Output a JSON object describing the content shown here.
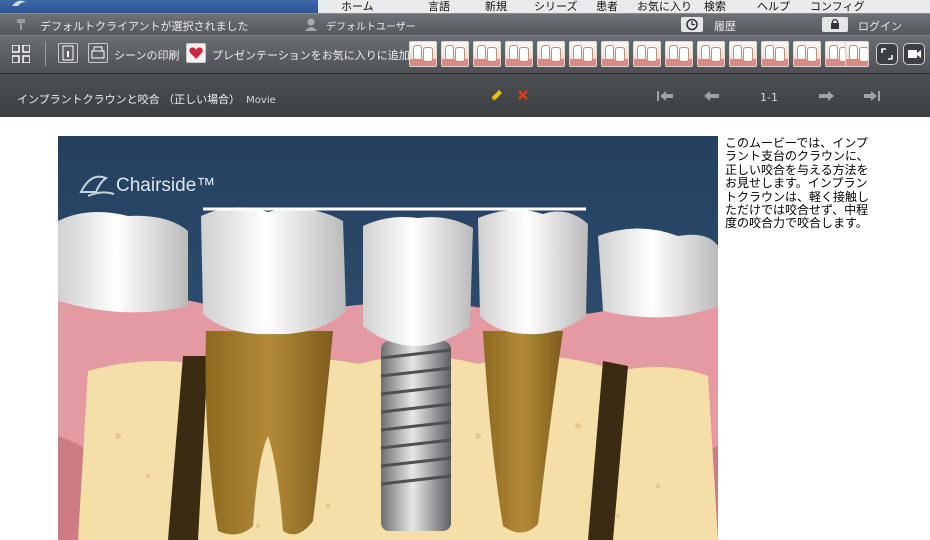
{
  "nav": {
    "items": [
      "ホーム",
      "言語",
      "新規",
      "シリーズ",
      "患者",
      "お気に入り",
      "検索",
      "ヘルプ",
      "コンフィグ"
    ]
  },
  "status": {
    "client": "デフォルトクライアントが選択されました",
    "user": "デフォルトユーザー",
    "history": "履歴",
    "login": "ログイン"
  },
  "toolbar": {
    "print_label": "シーンの印刷",
    "favorite_label": "プレゼンテーションをお気に入りに追加",
    "thumbnail_count": 15
  },
  "titlebar": {
    "title": "インプラントクラウンと咬合 （正しい場合）",
    "media_type": "Movie",
    "pager": "1-1"
  },
  "media": {
    "brand": "Chairside™"
  },
  "caption": "このムービーでは、インプラント支台のクラウンに、正しい咬合を与える方法をお見せします。インプラントクラウンは、軽く接触しただけでは咬合せず、中程度の咬合力で咬合します。",
  "colors": {
    "accent_yellow": "#f2c200",
    "delete_red": "#e23b1e",
    "gum_pink": "#e39aa2",
    "bone": "#f3dfa7",
    "root": "#a17a2c",
    "background_blue": "#2d4a6e"
  }
}
